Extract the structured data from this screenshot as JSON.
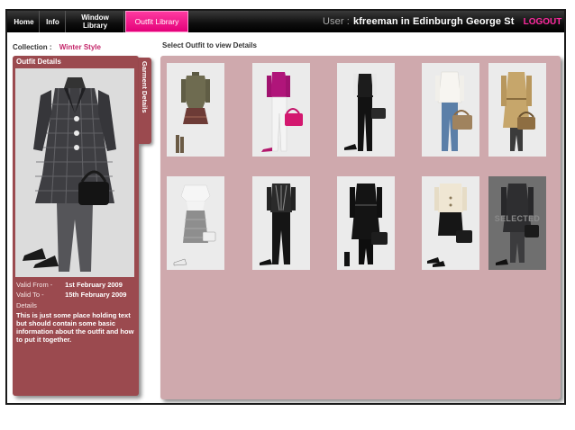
{
  "nav": {
    "home": "Home",
    "info": "Info",
    "window_library_line1": "Window",
    "window_library_line2": "Library",
    "outfit_library": "Outfit Library"
  },
  "user": {
    "label": "User :",
    "name": "kfreeman in Edinburgh George St",
    "logout": "LOGOUT"
  },
  "collection": {
    "label": "Collection :",
    "value": "Winter Style"
  },
  "select_prompt": "Select Outfit to view Details",
  "details_panel": {
    "title": "Outfit Details",
    "garment_tab": "Garment Details",
    "valid_from_label": "Valid From -",
    "valid_from": "1st February 2009",
    "valid_to_label": "Valid To -",
    "valid_to": "15th February 2009",
    "details_label": "Details",
    "details_text": "This is just some place holding text but should contain some basic information about the outfit and how to put it together."
  },
  "outfits": [
    {
      "icon": "outfit-olive-jacket-plaid-skirt"
    },
    {
      "icon": "outfit-magenta-top-white-trousers"
    },
    {
      "icon": "outfit-black-waistcoat-trousers"
    },
    {
      "icon": "outfit-white-blouse-jeans"
    },
    {
      "icon": "outfit-camel-trench-coat"
    },
    {
      "icon": "outfit-white-shirt-tweed-skirt"
    },
    {
      "icon": "outfit-patterned-top-black-trousers"
    },
    {
      "icon": "outfit-black-belted-coat"
    },
    {
      "icon": "outfit-cream-jacket-black-skirt"
    },
    {
      "icon": "outfit-grey-check-coat",
      "selected": true,
      "selected_label": "SELECTED"
    }
  ],
  "colors": {
    "accent_pink": "#e4007a",
    "panel_maroon": "#9b4a4f",
    "grid_bg": "#cfa9ad",
    "collection_value": "#c4266a"
  }
}
